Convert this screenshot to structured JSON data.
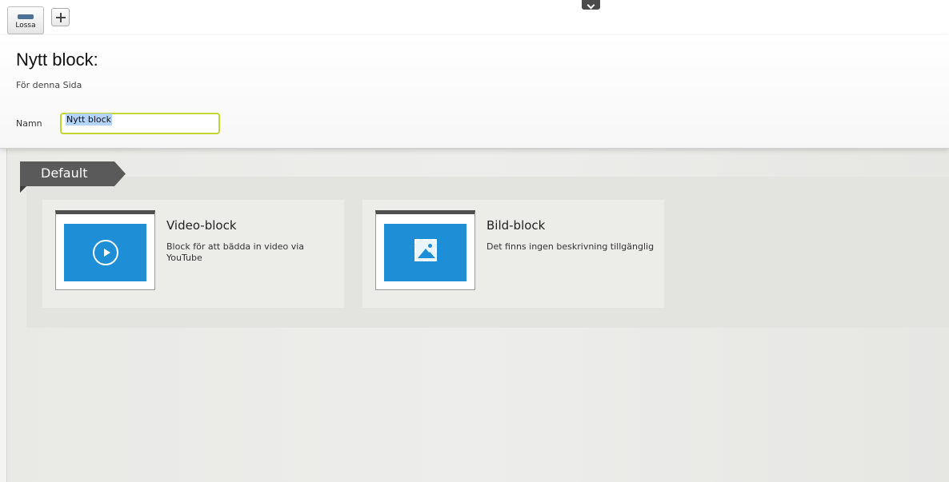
{
  "toolbar": {
    "lossa_label": "Lossa",
    "add_icon": "plus-icon",
    "collapse_icon": "chevron-down-icon"
  },
  "form": {
    "title": "Nytt block:",
    "subtitle": "För denna Sida",
    "name_label": "Namn",
    "name_value": "Nytt block"
  },
  "category": {
    "label": "Default"
  },
  "blocks": [
    {
      "name": "Video-block",
      "description": "Block för att bädda in video via YouTube",
      "icon": "play-icon"
    },
    {
      "name": "Bild-block",
      "description": "Det finns ingen beskrivning tillgänglig",
      "icon": "image-icon"
    }
  ],
  "colors": {
    "accent_blue": "#1e8fd6",
    "input_focus": "#c1d72f",
    "ribbon": "#5a5a5a"
  }
}
